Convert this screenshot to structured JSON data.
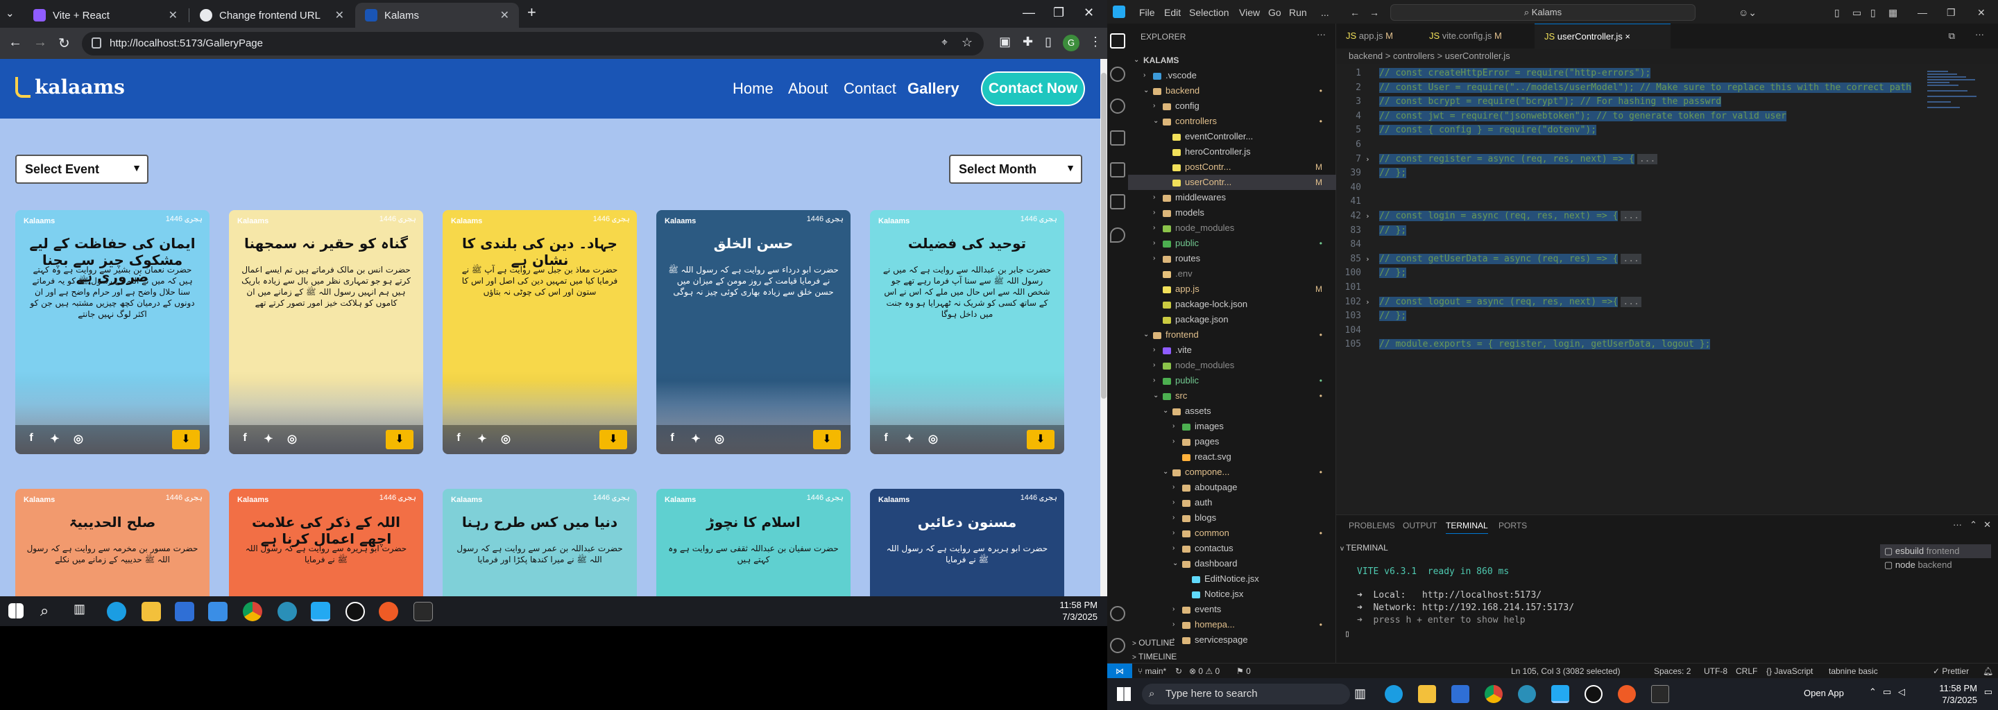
{
  "chrome": {
    "tabs": [
      {
        "title": "Vite + React",
        "favicon_color": "#8f5cff"
      },
      {
        "title": "Change frontend URL",
        "favicon_color": "#e8eaed"
      },
      {
        "title": "Kalams",
        "favicon_color": "#1a55b5"
      }
    ],
    "new_tab": "+",
    "url": "http://localhost:5173/GalleryPage",
    "profile_initial": "G"
  },
  "site": {
    "logo": "kalaams",
    "nav": [
      "Home",
      "About",
      "Contact",
      "Gallery"
    ],
    "contact_button": "Contact Now",
    "select_event": "Select Event",
    "select_month": "Select Month",
    "card_logo": "Kalaams",
    "card_cal": "1446 ہجری",
    "share_icons": [
      "facebook-icon",
      "twitter-icon",
      "instagram-icon"
    ],
    "download_icon": "download-icon",
    "cards": [
      {
        "title": "ایمان کی حفاظت کے لیے مشکوک چیز سے بچنا ضروری ہے",
        "body": "حضرت نعمان بن بشیر سے روایت ہے وہ کہتے ہیں کہ میں نے اللہ کے رسول ﷺ کو یہ فرماتے سنا حلال واضح ہے اور حرام واضح ہے اور ان دونوں کے درمیان کچھ چیزیں مشتبہ ہیں جن کو اکثر لوگ نہیں جانتے",
        "bg": "#7ed0f0",
        "dark": false
      },
      {
        "title": "گناہ کو حقیر نہ سمجھنا",
        "body": "حضرت انس بن مالک فرماتے ہیں تم ایسے اعمال کرتے ہو جو تمہاری نظر میں بال سے زیادہ باریک ہیں ہم انہیں رسول اللہ ﷺ کے زمانے میں ان کاموں کو ہلاکت خیز امور تصور کرتے تھے",
        "bg": "#f6e7a8",
        "dark": false
      },
      {
        "title": "جہاد۔ دین کی بلندی کا نشان ہے",
        "body": "حضرت معاذ بن جبل سے روایت ہے آپ ﷺ نے فرمایا کیا میں تمہیں دین کی اصل اور اس کا ستون اور اس کی چوٹی نہ بتاؤں",
        "bg": "#f7d84a",
        "dark": false
      },
      {
        "title": "حسن الخلق",
        "body": "حضرت ابو درداء سے روایت ہے کہ رسول اللہ ﷺ نے فرمایا قیامت کے روز مومن کے میزان میں حسن خلق سے زیادہ بھاری کوئی چیز نہ ہوگی",
        "bg": "#2c5a82",
        "dark": true
      },
      {
        "title": "توحید کی فضیلت",
        "body": "حضرت جابر بن عبداللہ سے روایت ہے کہ میں نے رسول اللہ ﷺ سے سنا آپ فرما رہے تھے جو شخص اللہ سے اس حال میں ملے کہ اس نے اس کے ساتھ کسی کو شریک نہ ٹھہرایا ہو وہ جنت میں داخل ہوگا",
        "bg": "#78dbe4",
        "dark": false
      },
      {
        "title": "صلح الحدیبیۃ",
        "body": "حضرت مسور بن مخرمہ سے روایت ہے کہ رسول اللہ ﷺ حدیبیہ کے زمانے میں نکلے",
        "bg": "#f29a6e",
        "dark": false
      },
      {
        "title": "اللہ کے ذکر کی علامت اچھے اعمال کرنا ہے",
        "body": "حضرت ابو ہریرہ سے روایت ہے کہ رسول اللہ ﷺ نے فرمایا",
        "bg": "#f26f45",
        "dark": false
      },
      {
        "title": "دنیا میں کس طرح رہنا",
        "body": "حضرت عبداللہ بن عمر سے روایت ہے کہ رسول اللہ ﷺ نے میرا کندھا پکڑا اور فرمایا",
        "bg": "#7fd0d8",
        "dark": false
      },
      {
        "title": "اسلام کا نچوڑ",
        "body": "حضرت سفیان بن عبداللہ ثقفی سے روایت ہے وہ کہتے ہیں",
        "bg": "#5fd0d0",
        "dark": false
      },
      {
        "title": "مسنون دعائیں",
        "body": "حضرت ابو ہریرہ سے روایت ہے کہ رسول اللہ ﷺ نے فرمایا",
        "bg": "#23457a",
        "dark": true
      }
    ]
  },
  "left_taskbar": {
    "time": "11:58 PM",
    "date": "7/3/2025"
  },
  "vscode": {
    "menu": [
      "File",
      "Edit",
      "Selection",
      "View",
      "Go",
      "Run",
      "..."
    ],
    "command_center": "Kalams",
    "explorer_title": "EXPLORER",
    "tabs": [
      {
        "label": "app.js",
        "badge": "M"
      },
      {
        "label": "vite.config.js",
        "badge": "M"
      },
      {
        "label": "userController.js",
        "badge": "×"
      }
    ],
    "breadcrumb": "backend > controllers > userController.js",
    "tree": [
      {
        "label": "KALAMS",
        "depth": 0,
        "tw": "v",
        "color": "",
        "badge": ""
      },
      {
        "label": ".vscode",
        "depth": 1,
        "tw": ">",
        "color": "#3d9ad8",
        "badge": ""
      },
      {
        "label": "backend",
        "depth": 1,
        "tw": "v",
        "color": "#dcb67a",
        "badge": "•",
        "text_color": "#e2c08d"
      },
      {
        "label": "config",
        "depth": 2,
        "tw": ">",
        "color": "#dcb67a",
        "badge": ""
      },
      {
        "label": "controllers",
        "depth": 2,
        "tw": "v",
        "color": "#dcb67a",
        "badge": "•",
        "text_color": "#e2c08d"
      },
      {
        "label": "eventController...",
        "depth": 3,
        "tw": "",
        "color": "#f1e05a",
        "badge": ""
      },
      {
        "label": "heroController.js",
        "depth": 3,
        "tw": "",
        "color": "#f1e05a",
        "badge": ""
      },
      {
        "label": "postContr...",
        "depth": 3,
        "tw": "",
        "color": "#f1e05a",
        "badge": "M",
        "text_color": "#e2c08d"
      },
      {
        "label": "userContr...",
        "depth": 3,
        "tw": "",
        "color": "#f1e05a",
        "badge": "M",
        "text_color": "#e2c08d",
        "sel": true
      },
      {
        "label": "middlewares",
        "depth": 2,
        "tw": ">",
        "color": "#dcb67a",
        "badge": ""
      },
      {
        "label": "models",
        "depth": 2,
        "tw": ">",
        "color": "#dcb67a",
        "badge": ""
      },
      {
        "label": "node_modules",
        "depth": 2,
        "tw": ">",
        "color": "#8bc34a",
        "badge": "",
        "text_color": "#8b8b8b"
      },
      {
        "label": "public",
        "depth": 2,
        "tw": ">",
        "color": "#4caf50",
        "badge": "•",
        "text_color": "#73c991"
      },
      {
        "label": "routes",
        "depth": 2,
        "tw": ">",
        "color": "#dcb67a",
        "badge": ""
      },
      {
        "label": ".env",
        "depth": 2,
        "tw": "",
        "color": "#e5c07b",
        "badge": "",
        "text_color": "#8b8b8b"
      },
      {
        "label": "app.js",
        "depth": 2,
        "tw": "",
        "color": "#f1e05a",
        "badge": "M",
        "text_color": "#e2c08d"
      },
      {
        "label": "package-lock.json",
        "depth": 2,
        "tw": "",
        "color": "#cbcb41",
        "badge": ""
      },
      {
        "label": "package.json",
        "depth": 2,
        "tw": "",
        "color": "#cbcb41",
        "badge": ""
      },
      {
        "label": "frontend",
        "depth": 1,
        "tw": "v",
        "color": "#dcb67a",
        "badge": "•",
        "text_color": "#e2c08d"
      },
      {
        "label": ".vite",
        "depth": 2,
        "tw": ">",
        "color": "#8f5cff",
        "badge": ""
      },
      {
        "label": "node_modules",
        "depth": 2,
        "tw": ">",
        "color": "#8bc34a",
        "badge": "",
        "text_color": "#8b8b8b"
      },
      {
        "label": "public",
        "depth": 2,
        "tw": ">",
        "color": "#4caf50",
        "badge": "•",
        "text_color": "#73c991"
      },
      {
        "label": "src",
        "depth": 2,
        "tw": "v",
        "color": "#4caf50",
        "badge": "•",
        "text_color": "#e2c08d"
      },
      {
        "label": "assets",
        "depth": 3,
        "tw": "v",
        "color": "#dcb67a",
        "badge": ""
      },
      {
        "label": "images",
        "depth": 4,
        "tw": ">",
        "color": "#4caf50",
        "badge": ""
      },
      {
        "label": "pages",
        "depth": 4,
        "tw": ">",
        "color": "#dcb67a",
        "badge": ""
      },
      {
        "label": "react.svg",
        "depth": 4,
        "tw": "",
        "color": "#ffb13b",
        "badge": ""
      },
      {
        "label": "compone...",
        "depth": 3,
        "tw": "v",
        "color": "#dcb67a",
        "badge": "•",
        "text_color": "#e2c08d"
      },
      {
        "label": "aboutpage",
        "depth": 4,
        "tw": ">",
        "color": "#dcb67a",
        "badge": ""
      },
      {
        "label": "auth",
        "depth": 4,
        "tw": ">",
        "color": "#dcb67a",
        "badge": ""
      },
      {
        "label": "blogs",
        "depth": 4,
        "tw": ">",
        "color": "#dcb67a",
        "badge": ""
      },
      {
        "label": "common",
        "depth": 4,
        "tw": ">",
        "color": "#dcb67a",
        "badge": "•",
        "text_color": "#e2c08d"
      },
      {
        "label": "contactus",
        "depth": 4,
        "tw": ">",
        "color": "#dcb67a",
        "badge": ""
      },
      {
        "label": "dashboard",
        "depth": 4,
        "tw": "v",
        "color": "#dcb67a",
        "badge": ""
      },
      {
        "label": "EditNotice.jsx",
        "depth": 5,
        "tw": "",
        "color": "#61dafb",
        "badge": ""
      },
      {
        "label": "Notice.jsx",
        "depth": 5,
        "tw": "",
        "color": "#61dafb",
        "badge": ""
      },
      {
        "label": "events",
        "depth": 4,
        "tw": ">",
        "color": "#dcb67a",
        "badge": ""
      },
      {
        "label": "homepa...",
        "depth": 4,
        "tw": ">",
        "color": "#dcb67a",
        "badge": "•",
        "text_color": "#e2c08d"
      },
      {
        "label": "servicespage",
        "depth": 4,
        "tw": ">",
        "color": "#dcb67a",
        "badge": ""
      }
    ],
    "code": [
      {
        "n": "1",
        "text": "// const createHttpError = require(\"http-errors\");",
        "fold": ""
      },
      {
        "n": "2",
        "text": "// const User = require(\"../models/userModel\"); // Make sure to replace this with the correct path",
        "fold": ""
      },
      {
        "n": "3",
        "text": "// const bcrypt = require(\"bcrypt\"); // For hashing the passwrd",
        "fold": ""
      },
      {
        "n": "4",
        "text": "// const jwt = require(\"jsonwebtoken\"); // to generate token for valid user",
        "fold": ""
      },
      {
        "n": "5",
        "text": "// const { config } = require(\"dotenv\");",
        "fold": ""
      },
      {
        "n": "6",
        "text": "",
        "fold": ""
      },
      {
        "n": "7",
        "text": "// const register = async (req, res, next) => {",
        "fold": ">",
        "ellip": "..."
      },
      {
        "n": "39",
        "text": "// };",
        "fold": ""
      },
      {
        "n": "40",
        "text": "",
        "fold": ""
      },
      {
        "n": "41",
        "text": "",
        "fold": ""
      },
      {
        "n": "42",
        "text": "// const login = async (req, res, next) => {",
        "fold": ">",
        "ellip": "..."
      },
      {
        "n": "83",
        "text": "// };",
        "fold": ""
      },
      {
        "n": "84",
        "text": "",
        "fold": ""
      },
      {
        "n": "85",
        "text": "// const getUserData = async (req, res) => {",
        "fold": ">",
        "ellip": "..."
      },
      {
        "n": "100",
        "text": "// };",
        "fold": ""
      },
      {
        "n": "101",
        "text": "",
        "fold": ""
      },
      {
        "n": "102",
        "text": "// const logout = async (req, res, next) =>{",
        "fold": ">",
        "ellip": "..."
      },
      {
        "n": "102b",
        "text": "// };",
        "fold": ""
      },
      {
        "n": "103",
        "text": "",
        "fold": ""
      },
      {
        "n": "104",
        "text": "// module.exports = { register, login, getUserData, logout };",
        "fold": ""
      },
      {
        "n": "105",
        "text": "",
        "fold": ""
      }
    ],
    "line_numbers": [
      "1",
      "2",
      "3",
      "4",
      "5",
      "6",
      "7",
      "39",
      "40",
      "41",
      "42",
      "83",
      "84",
      "85",
      "100",
      "101",
      "102",
      "103",
      "104",
      "105"
    ],
    "panel_tabs": [
      "PROBLEMS",
      "OUTPUT",
      "TERMINAL",
      "PORTS"
    ],
    "terminal_header": "TERMINAL",
    "terminal": [
      "VITE v6.3.1  ready in 860 ms",
      "",
      "➜  Local:   http://localhost:5173/",
      "➜  Network: http://192.168.214.157:5173/",
      "➜  press h + enter to show help"
    ],
    "terminals_list": [
      {
        "name": "esbuild",
        "cwd": "frontend"
      },
      {
        "name": "node",
        "cwd": "backend"
      }
    ],
    "outline": "OUTLINE",
    "timeline": "TIMELINE",
    "status": {
      "branch": "main*",
      "errors": "⊗ 0 ⚠ 0",
      "ports": "⚑ 0",
      "position": "Ln 105, Col 3 (3082 selected)",
      "spaces": "Spaces: 2",
      "encoding": "UTF-8",
      "eol": "CRLF",
      "lang": "{} JavaScript",
      "tabnine": "tabnine basic",
      "prettier": "✓ Prettier"
    }
  },
  "right_taskbar": {
    "search": "Type here to search",
    "time": "11:58 PM",
    "date": "7/3/2025",
    "open_app": "Open App"
  }
}
